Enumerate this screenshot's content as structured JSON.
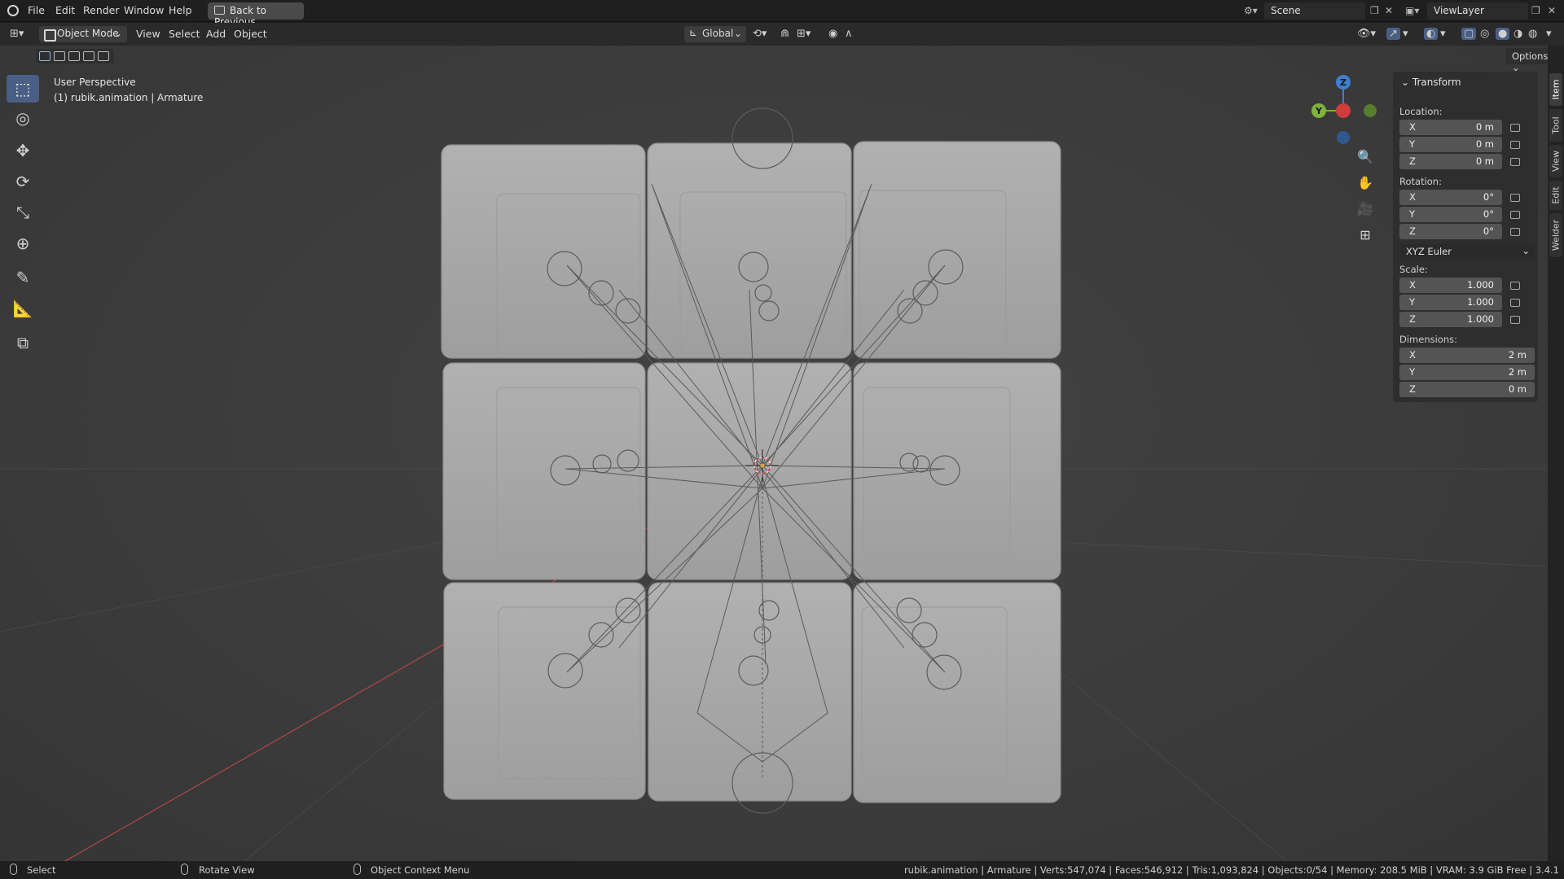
{
  "topbar": {
    "menus": [
      "File",
      "Edit",
      "Render",
      "Window",
      "Help"
    ],
    "back_button": "Back to Previous",
    "scene": "Scene",
    "view_layer": "ViewLayer"
  },
  "header": {
    "mode": "Object Mode",
    "menus": [
      "View",
      "Select",
      "Add",
      "Object"
    ],
    "orientation": "Global",
    "options": "Options"
  },
  "viewport": {
    "perspective": "User Perspective",
    "object_info": "(1) rubik.animation | Armature"
  },
  "gizmo": {
    "z": "Z",
    "y": "Y",
    "x_color": "#d03c3c",
    "y_color": "#80b33c",
    "z_color": "#3d7fcf"
  },
  "npanel": {
    "title": "Transform",
    "location_label": "Location:",
    "location": {
      "x": "0 m",
      "y": "0 m",
      "z": "0 m"
    },
    "rotation_label": "Rotation:",
    "rotation": {
      "x": "0°",
      "y": "0°",
      "z": "0°"
    },
    "rotation_mode": "XYZ Euler",
    "scale_label": "Scale:",
    "scale": {
      "x": "1.000",
      "y": "1.000",
      "z": "1.000"
    },
    "dimensions_label": "Dimensions:",
    "dimensions": {
      "x": "2 m",
      "y": "2 m",
      "z": "0 m"
    },
    "axes": {
      "x": "X",
      "y": "Y",
      "z": "Z"
    }
  },
  "tabs": [
    "Item",
    "Tool",
    "View",
    "Edit",
    "Welder"
  ],
  "statusbar": {
    "left_click": "Select",
    "middle_click": "Rotate View",
    "right_click": "Object Context Menu",
    "stats": "rubik.animation | Armature | Verts:547,074 | Faces:546,912 | Tris:1,093,824 | Objects:0/54 | Memory: 208.5 MiB | VRAM: 3.9 GiB Free | 3.4.1"
  },
  "colors": {
    "accent": "#4a5f84",
    "viewport_bg": "#3c3c3c",
    "cube": "#a9a9a9"
  }
}
